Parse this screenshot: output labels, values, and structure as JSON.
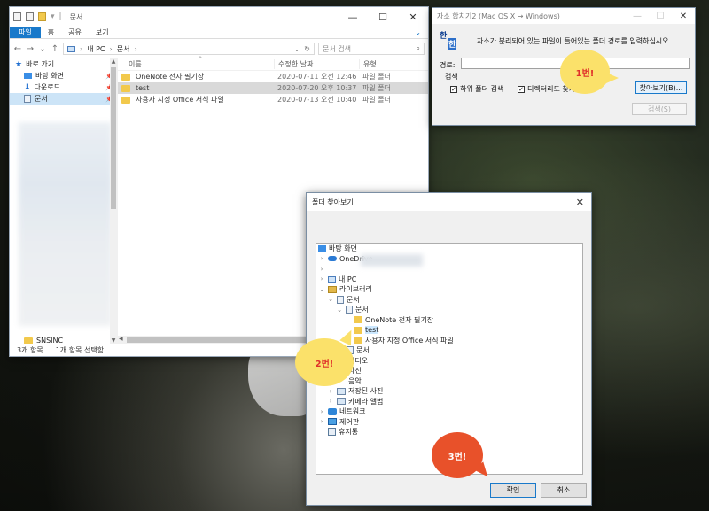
{
  "explorer": {
    "title": "문서",
    "ribbon": {
      "file": "파일",
      "home": "홈",
      "share": "공유",
      "view": "보기"
    },
    "address": {
      "pc": "내 PC",
      "folder": "문서"
    },
    "search_placeholder": "문서 검색",
    "columns": {
      "name": "이름",
      "date": "수정한 날짜",
      "type": "유형"
    },
    "files": [
      {
        "name": "OneNote 전자 필기장",
        "date": "2020-07-11 오전 12:46",
        "type": "파일 폴더"
      },
      {
        "name": "test",
        "date": "2020-07-20 오후 10:37",
        "type": "파일 폴더"
      },
      {
        "name": "사용자 지정 Office 서식 파일",
        "date": "2020-07-13 오전 10:40",
        "type": "파일 폴더"
      }
    ],
    "nav": {
      "quick": "바로 가기",
      "desktop": "바탕 화면",
      "downloads": "다운로드",
      "documents": "문서",
      "bottom": "SNSINC"
    },
    "status": {
      "count": "3개 항목",
      "selected": "1개 항목 선택함"
    }
  },
  "mac2win": {
    "title": "자소 합치기2 (Mac OS X → Windows)",
    "logo_top": "한",
    "logo_bottom": "한",
    "message": "자소가 분리되어 있는 파일이 들어있는 폴더 경로를 입력하십시오.",
    "path_label": "경로:",
    "path_value": "",
    "search_label": "검색",
    "subfolder": "하위 폴더 검색",
    "dirname": "디렉터리도 찾기",
    "browse_btn": "찾아보기(B)...",
    "find_btn": "검색(S)"
  },
  "browse": {
    "title": "폴더 찾아보기",
    "tree": {
      "desktop": "바탕 화면",
      "onedrive": "OneDrive",
      "mypc": "내 PC",
      "library": "라이브러리",
      "documents": "문서",
      "documents_sub": "문서",
      "onenote": "OneNote 전자 필기장",
      "test": "test",
      "office": "사용자 지정 Office 서식 파일",
      "documents2": "문서",
      "video": "비디오",
      "photos": "사진",
      "music": "음악",
      "saved_photos": "저장된 사진",
      "camera": "카메라 앨범",
      "network": "네트워크",
      "control": "제어판",
      "trash": "휴지통"
    },
    "ok": "확인",
    "cancel": "취소"
  },
  "callouts": {
    "one": "1번!",
    "two": "2번!",
    "three": "3번!"
  }
}
